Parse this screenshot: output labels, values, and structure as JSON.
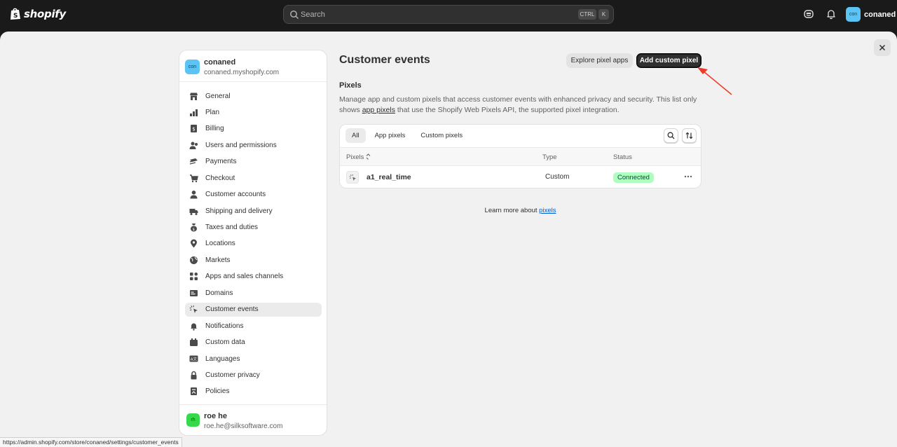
{
  "topbar": {
    "brand": "shopify",
    "search": {
      "placeholder": "Search",
      "kbd_ctrl": "CTRL",
      "kbd_k": "K"
    },
    "store_avatar": "con",
    "store_name": "conaned"
  },
  "sidebar": {
    "store": {
      "avatar": "con",
      "name": "conaned",
      "domain": "conaned.myshopify.com"
    },
    "items": [
      {
        "label": "General",
        "icon": "store-icon"
      },
      {
        "label": "Plan",
        "icon": "plan-icon"
      },
      {
        "label": "Billing",
        "icon": "billing-icon"
      },
      {
        "label": "Users and permissions",
        "icon": "users-icon"
      },
      {
        "label": "Payments",
        "icon": "payments-icon"
      },
      {
        "label": "Checkout",
        "icon": "cart-icon"
      },
      {
        "label": "Customer accounts",
        "icon": "person-icon"
      },
      {
        "label": "Shipping and delivery",
        "icon": "truck-icon"
      },
      {
        "label": "Taxes and duties",
        "icon": "tax-icon"
      },
      {
        "label": "Locations",
        "icon": "location-icon"
      },
      {
        "label": "Markets",
        "icon": "globe-icon"
      },
      {
        "label": "Apps and sales channels",
        "icon": "apps-icon"
      },
      {
        "label": "Domains",
        "icon": "domain-icon"
      },
      {
        "label": "Customer events",
        "icon": "cursor-click-icon",
        "active": true
      },
      {
        "label": "Notifications",
        "icon": "bell-icon"
      },
      {
        "label": "Custom data",
        "icon": "custom-data-icon"
      },
      {
        "label": "Languages",
        "icon": "language-icon"
      },
      {
        "label": "Customer privacy",
        "icon": "lock-icon"
      },
      {
        "label": "Policies",
        "icon": "policies-icon"
      }
    ],
    "user": {
      "avatar": "rh",
      "name": "roe he",
      "email": "roe.he@silksoftware.com"
    }
  },
  "main": {
    "title": "Customer events",
    "explore_label": "Explore pixel apps",
    "add_label": "Add custom pixel",
    "section_heading": "Pixels",
    "desc_before": "Manage app and custom pixels that access customer events with enhanced privacy and security. This list only shows ",
    "desc_link": "app pixels",
    "desc_after": " that use the Shopify Web Pixels API, the supported pixel integration.",
    "tabs": [
      "All",
      "App pixels",
      "Custom pixels"
    ],
    "columns": {
      "pixels": "Pixels",
      "type": "Type",
      "status": "Status"
    },
    "rows": [
      {
        "name": "a1_real_time",
        "type": "Custom",
        "status": "Connected"
      }
    ],
    "learn_prefix": "Learn more about ",
    "learn_link": "pixels"
  },
  "statusbar": {
    "url": "https://admin.shopify.com/store/conaned/settings/customer_events"
  },
  "colors": {
    "accent_dark": "#303030",
    "badge_bg": "#affebf",
    "link": "#005bd3",
    "annotation_arrow": "#ee3b2b"
  }
}
